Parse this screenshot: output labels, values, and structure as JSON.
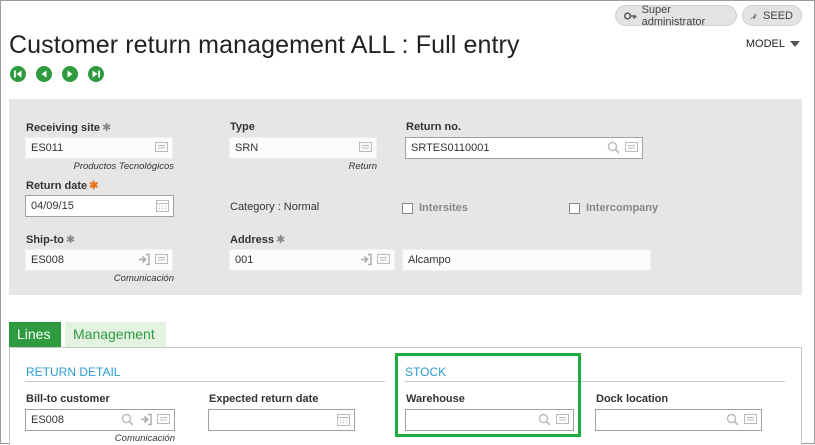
{
  "header": {
    "title": "Customer return management ALL : Full entry",
    "model_label": "MODEL",
    "user_role": "Super administrator",
    "folder": "SEED"
  },
  "header_form": {
    "receiving_site": {
      "label": "Receiving site",
      "value": "ES011",
      "description": "Productos Tecnológicos"
    },
    "type": {
      "label": "Type",
      "value": "SRN",
      "description": "Return"
    },
    "return_no": {
      "label": "Return no.",
      "value": "SRTES0110001"
    },
    "return_date": {
      "label": "Return date",
      "value": "04/09/15"
    },
    "category": {
      "label": "Category : Normal"
    },
    "intersites": {
      "label": "Intersites",
      "checked": false
    },
    "intercompany": {
      "label": "Intercompany",
      "checked": false
    },
    "ship_to": {
      "label": "Ship-to",
      "value": "ES008",
      "description": "Comunicación"
    },
    "address": {
      "label": "Address",
      "value": "001",
      "description": "Alcampo"
    }
  },
  "tabs": [
    {
      "label": "Lines",
      "active": true
    },
    {
      "label": "Management",
      "active": false
    }
  ],
  "lines": {
    "return_detail_title": "RETURN DETAIL",
    "stock_title": "STOCK",
    "bill_to_customer": {
      "label": "Bill-to customer",
      "value": "ES008",
      "description": "Comunicación"
    },
    "expected_return_date": {
      "label": "Expected return date",
      "value": ""
    },
    "warehouse": {
      "label": "Warehouse",
      "value": ""
    },
    "dock_location": {
      "label": "Dock location",
      "value": ""
    }
  },
  "colors": {
    "accent": "#2e9b3e",
    "section": "#2b9bd3",
    "required": "#e8741c",
    "highlight": "#1fab3f"
  }
}
